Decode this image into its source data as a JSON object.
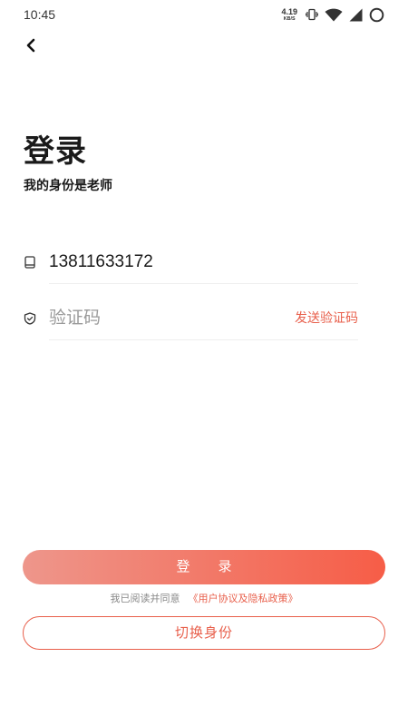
{
  "status_bar": {
    "time": "10:45",
    "net_speed_value": "4.19",
    "net_speed_unit": "KB/S",
    "icons": [
      "vibrate-icon",
      "wifi-icon",
      "signal-icon",
      "battery-icon"
    ]
  },
  "header": {
    "back_icon": "chevron-left-icon"
  },
  "title": "登录",
  "subtitle": "我的身份是老师",
  "form": {
    "phone": {
      "icon": "phone-icon",
      "value": "13811633172"
    },
    "code": {
      "icon": "shield-check-icon",
      "placeholder": "验证码",
      "value": "",
      "send_label": "发送验证码"
    }
  },
  "login_button": {
    "label": "登　录"
  },
  "agreement": {
    "prefix": "我已阅读并同意",
    "link": "《用户协议及隐私政策》"
  },
  "switch_button": {
    "label": "切换身份"
  },
  "colors": {
    "accent": "#E85F4B",
    "gradient_start": "#EE968B",
    "gradient_end": "#F65D47",
    "text": "#1a1a1a",
    "placeholder": "#9a9a9a",
    "muted": "#888888",
    "divider": "#eeeeee"
  }
}
